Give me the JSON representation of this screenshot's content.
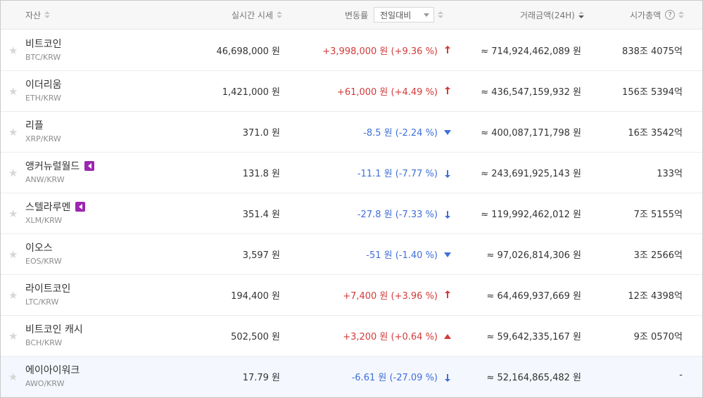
{
  "header": {
    "asset_label": "자산",
    "price_label": "실시간 시세",
    "change_label": "변동률",
    "change_select_value": "전일대비",
    "volume_label": "거래금액(24H)",
    "mcap_label": "시가총액",
    "help_symbol": "?"
  },
  "icons": {
    "star": "star-icon",
    "sort": "sort-arrows-icon",
    "help": "question-circle-icon",
    "warning_badge": "warning-badge-icon"
  },
  "colors": {
    "up": "#d33a3a",
    "down": "#3f6fd9",
    "badge": "#9c27b0",
    "highlight_row": "#f4f7fd"
  },
  "rows": [
    {
      "name": "비트코인",
      "pair": "BTC/KRW",
      "badge": false,
      "price": "46,698,000 원",
      "change": "+3,998,000 원 (+9.36 %)",
      "direction": "up",
      "arrow": "small-up",
      "volume": "≈ 714,924,462,089 원",
      "mcap": "838조 4075억"
    },
    {
      "name": "이더리움",
      "pair": "ETH/KRW",
      "badge": false,
      "price": "1,421,000 원",
      "change": "+61,000 원 (+4.49 %)",
      "direction": "up",
      "arrow": "small-up",
      "volume": "≈ 436,547,159,932 원",
      "mcap": "156조 5394억"
    },
    {
      "name": "리플",
      "pair": "XRP/KRW",
      "badge": false,
      "price": "371.0 원",
      "change": "-8.5 원 (-2.24 %)",
      "direction": "down",
      "arrow": "tri-down",
      "volume": "≈ 400,087,171,798 원",
      "mcap": "16조 3542억"
    },
    {
      "name": "앵커뉴럴월드",
      "pair": "ANW/KRW",
      "badge": true,
      "price": "131.8 원",
      "change": "-11.1 원 (-7.77 %)",
      "direction": "down",
      "arrow": "small-down",
      "volume": "≈ 243,691,925,143 원",
      "mcap": "133억"
    },
    {
      "name": "스텔라루멘",
      "pair": "XLM/KRW",
      "badge": true,
      "price": "351.4 원",
      "change": "-27.8 원 (-7.33 %)",
      "direction": "down",
      "arrow": "small-down",
      "volume": "≈ 119,992,462,012 원",
      "mcap": "7조 5155억"
    },
    {
      "name": "이오스",
      "pair": "EOS/KRW",
      "badge": false,
      "price": "3,597 원",
      "change": "-51 원 (-1.40 %)",
      "direction": "down",
      "arrow": "tri-down",
      "volume": "≈ 97,026,814,306 원",
      "mcap": "3조 2566억"
    },
    {
      "name": "라이트코인",
      "pair": "LTC/KRW",
      "badge": false,
      "price": "194,400 원",
      "change": "+7,400 원 (+3.96 %)",
      "direction": "up",
      "arrow": "small-up",
      "volume": "≈ 64,469,937,669 원",
      "mcap": "12조 4398억"
    },
    {
      "name": "비트코인 캐시",
      "pair": "BCH/KRW",
      "badge": false,
      "price": "502,500 원",
      "change": "+3,200 원 (+0.64 %)",
      "direction": "up",
      "arrow": "tri-up",
      "volume": "≈ 59,642,335,167 원",
      "mcap": "9조 0570억"
    },
    {
      "name": "에이아이워크",
      "pair": "AWO/KRW",
      "badge": false,
      "price": "17.79 원",
      "change": "-6.61 원 (-27.09 %)",
      "direction": "down",
      "arrow": "small-down",
      "volume": "≈ 52,164,865,482 원",
      "mcap": "-"
    }
  ]
}
